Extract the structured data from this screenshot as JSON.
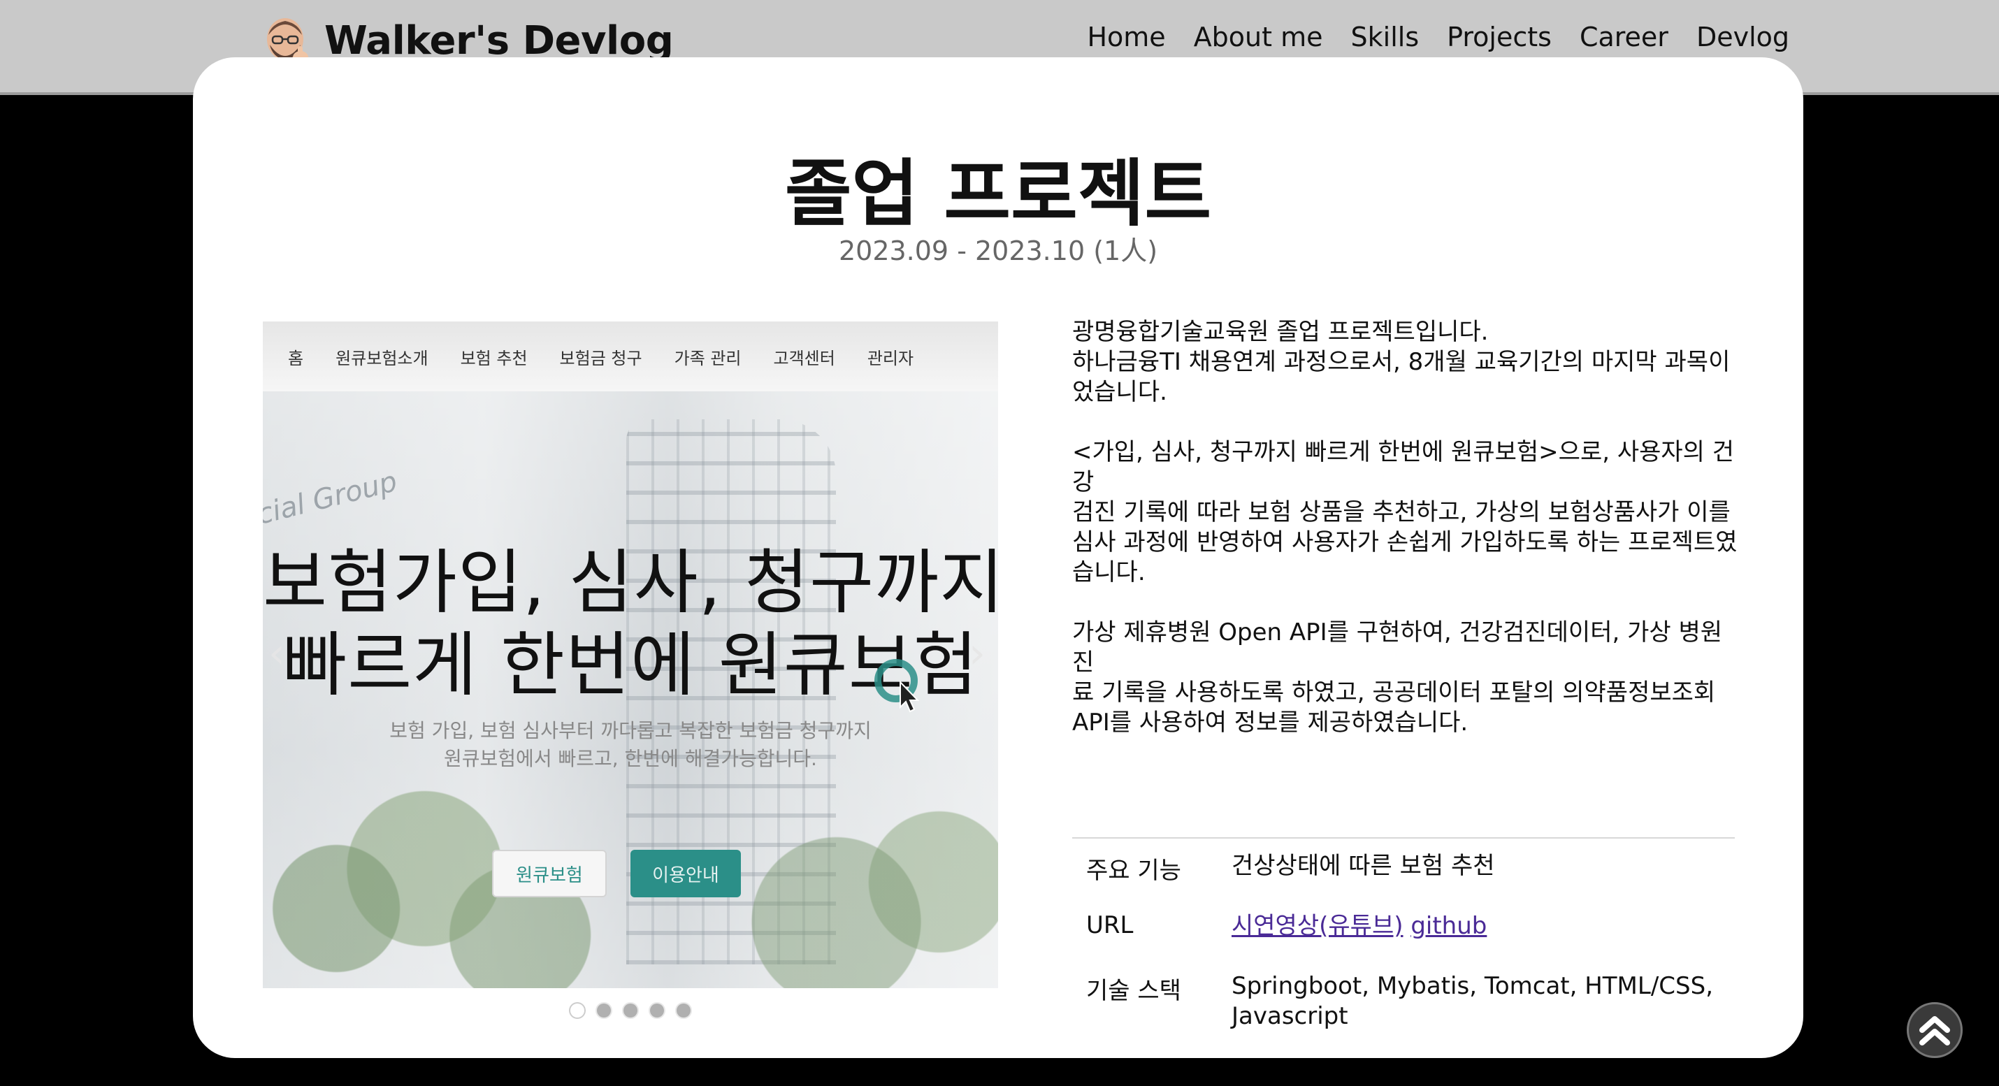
{
  "header": {
    "brand": "Walker's Devlog",
    "nav": [
      "Home",
      "About me",
      "Skills",
      "Projects",
      "Career",
      "Devlog"
    ]
  },
  "project": {
    "title": "졸업 프로젝트",
    "period": "2023.09 - 2023.10 (1人)"
  },
  "screenshot": {
    "nav": [
      "홈",
      "원큐보험소개",
      "보험 추천",
      "보험금 청구",
      "가족 관리",
      "고객센터",
      "관리자"
    ],
    "corner_text": "cial Group",
    "hero_line1": "보험가입, 심사, 청구까지",
    "hero_line2": "빠르게 한번에 원큐보험",
    "sub_line1": "보험 가입, 보험 심사부터 까다롭고 복잡한 보험금 청구까지",
    "sub_line2": "원큐보험에서 빠르고, 한번에 해결가능합니다.",
    "btn_primary": "원큐보험",
    "btn_secondary": "이용안내",
    "prev": "‹",
    "next": "›",
    "slide_count": 5,
    "active_slide": 1
  },
  "description": {
    "p1_line1": "광명융합기술교육원 졸업 프로젝트입니다.",
    "p1_line2": "하나금융TI 채용연계 과정으로서, 8개월 교육기간의 마지막 과목이",
    "p1_line3": "었습니다.",
    "p2_line1": "<가입, 심사, 청구까지 빠르게 한번에 원큐보험>으로, 사용자의 건강",
    "p2_line2": "검진 기록에 따라 보험 상품을 추천하고, 가상의 보험상품사가 이를",
    "p2_line3": "심사 과정에 반영하여 사용자가 손쉽게 가입하도록 하는 프로젝트였",
    "p2_line4": "습니다.",
    "p3_line1": "가상 제휴병원 Open API를 구현하여, 건강검진데이터, 가상 병원 진",
    "p3_line2": "료 기록을 사용하도록 하였고, 공공데이터 포탈의 의약품정보조회",
    "p3_line3": "API를 사용하여 정보를 제공하였습니다."
  },
  "info": {
    "feature_label": "주요 기능",
    "feature_value": "건상상태에 따른 보험 추천",
    "url_label": "URL",
    "url_link1": "시연영상(유튜브)",
    "url_link2": "github",
    "stack_label": "기술 스택",
    "stack_line1": "Springboot, Mybatis, Tomcat, HTML/CSS,",
    "stack_line2": "Javascript"
  },
  "colors": {
    "header_bg": "#c9c9c9",
    "page_bg": "#000000",
    "card_bg": "#ffffff",
    "accent_teal": "#2b8f88",
    "link": "#4a2a96"
  },
  "icons": {
    "avatar": "memoji-avatar-icon",
    "to_top": "double-chevron-up-icon"
  }
}
